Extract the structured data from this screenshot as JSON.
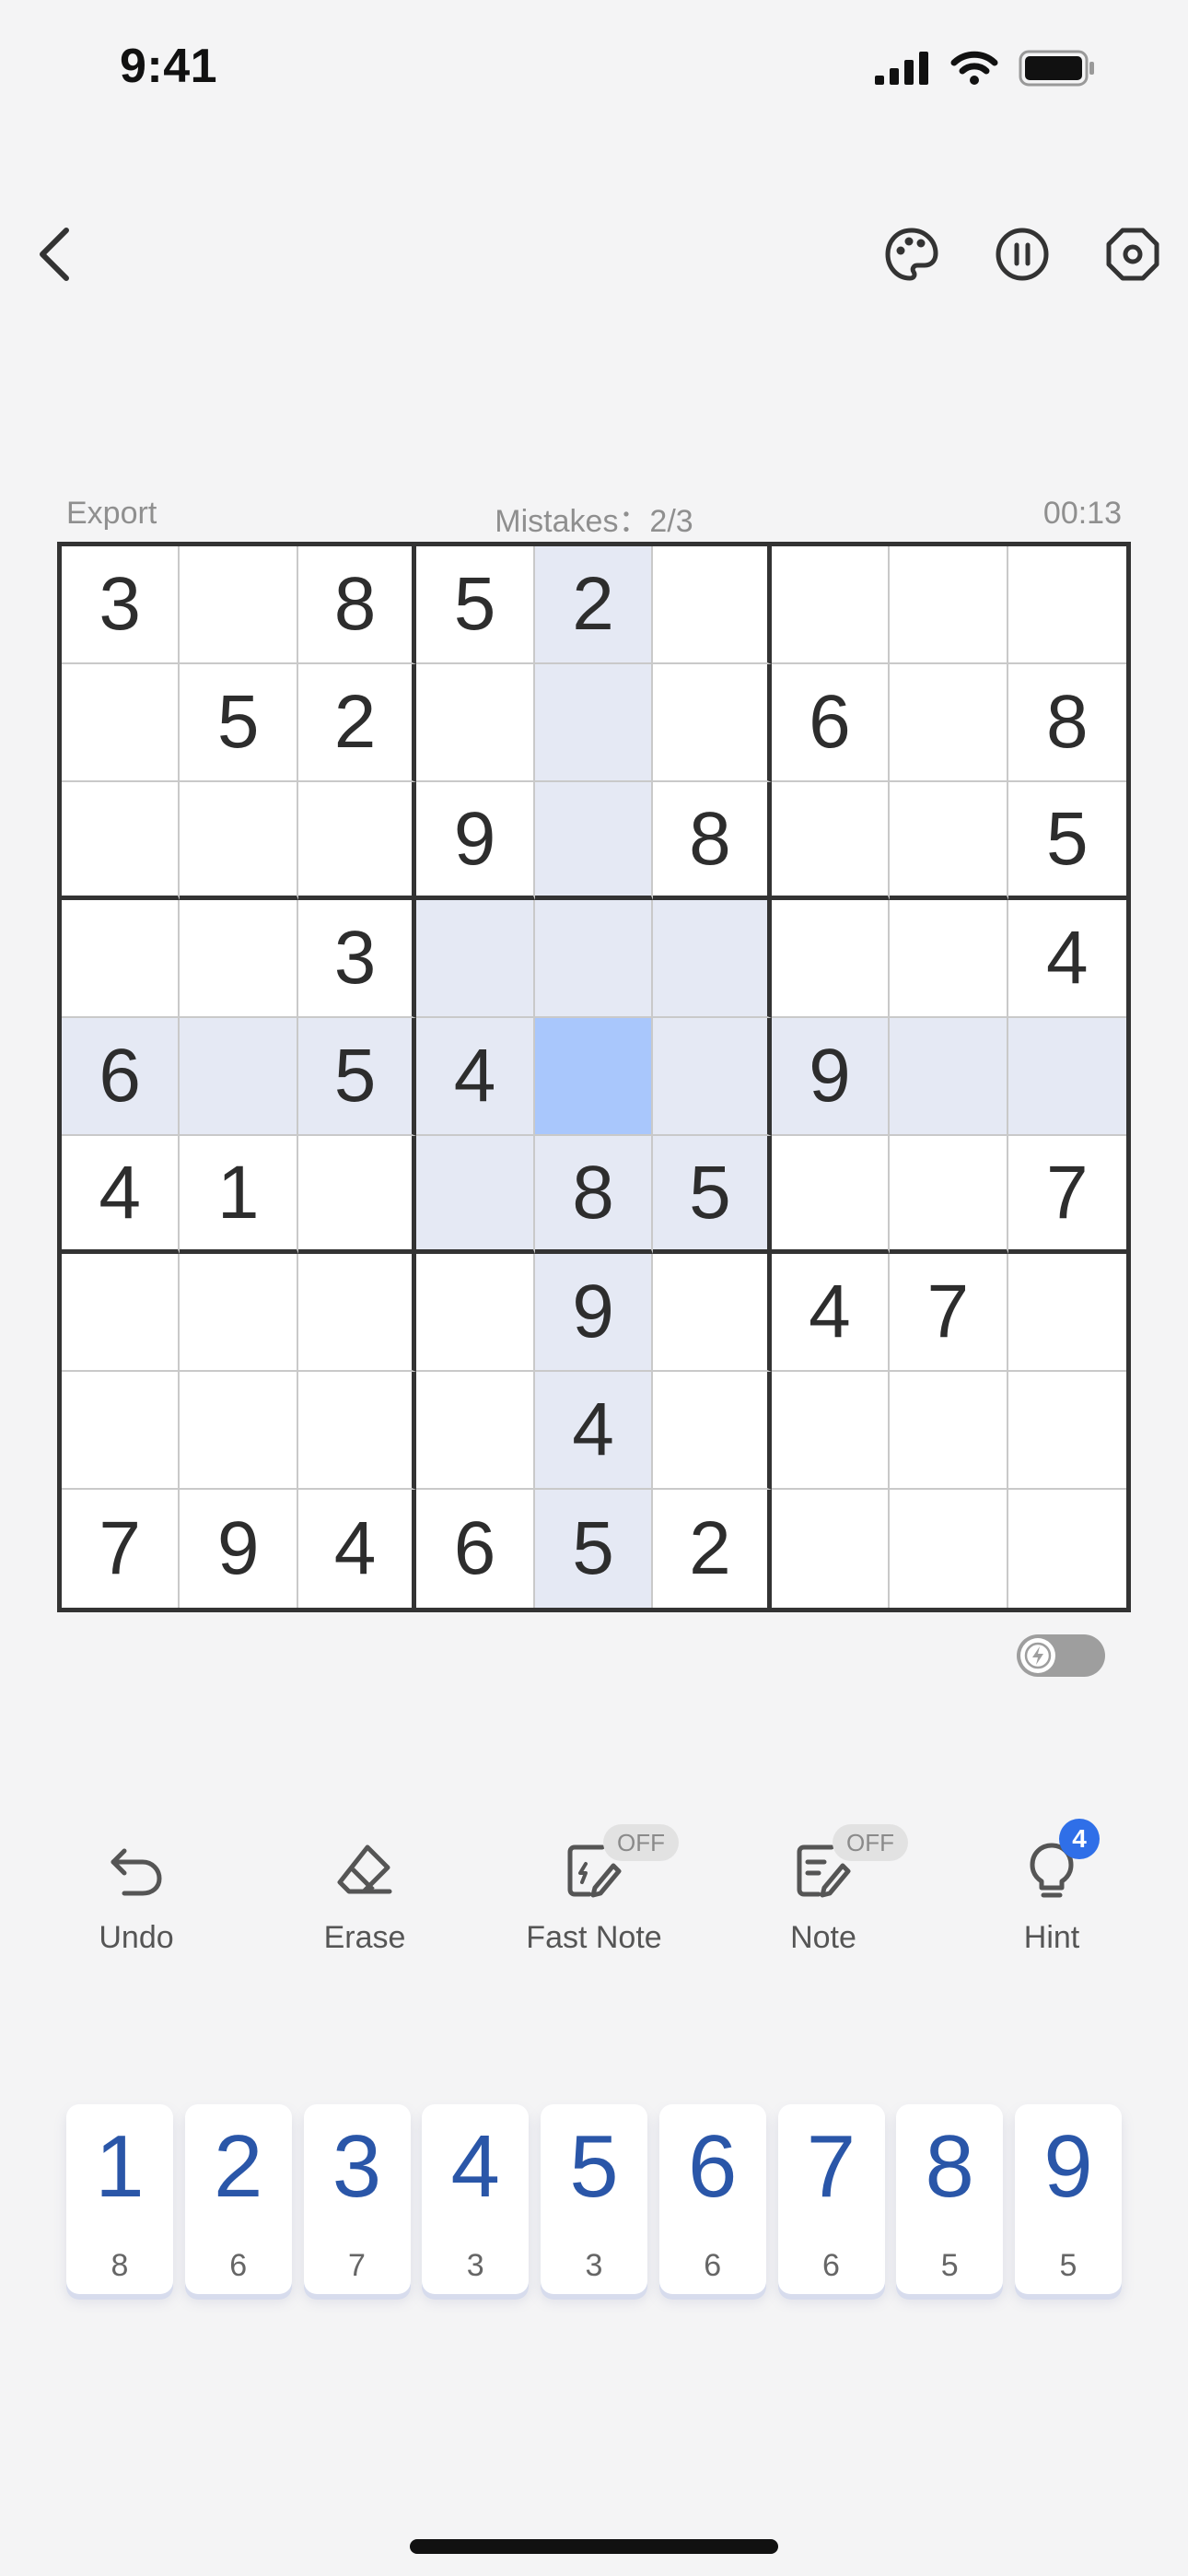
{
  "status_bar": {
    "time": "9:41"
  },
  "header": {
    "back_icon": "chevron-left-icon",
    "palette_icon": "palette-icon",
    "pause_icon": "pause-icon",
    "settings_icon": "settings-icon"
  },
  "info": {
    "export_label": "Export",
    "mistakes_label": "Mistakes：2/3",
    "timer": "00:13"
  },
  "board": {
    "rows": [
      [
        "3",
        "",
        "8",
        "5",
        "2",
        "",
        "",
        "",
        ""
      ],
      [
        "",
        "5",
        "2",
        "",
        "",
        "",
        "6",
        "",
        "8"
      ],
      [
        "",
        "",
        "",
        "9",
        "",
        "8",
        "",
        "",
        "5"
      ],
      [
        "",
        "",
        "3",
        "",
        "",
        "",
        "",
        "",
        "4"
      ],
      [
        "6",
        "",
        "5",
        "4",
        "",
        "",
        "9",
        "",
        ""
      ],
      [
        "4",
        "1",
        "",
        "",
        "8",
        "5",
        "",
        "",
        "7"
      ],
      [
        "",
        "",
        "",
        "",
        "9",
        "",
        "4",
        "7",
        ""
      ],
      [
        "",
        "",
        "",
        "",
        "4",
        "",
        "",
        "",
        ""
      ],
      [
        "7",
        "9",
        "4",
        "6",
        "5",
        "2",
        "",
        "",
        ""
      ]
    ],
    "selected": {
      "row": 4,
      "col": 4
    },
    "colors": {
      "highlight": "#e5e9f4",
      "selected": "#a9c7fc",
      "given": "#2d2d2d"
    }
  },
  "quick_toggle": {
    "icon": "lightning-icon",
    "on": false
  },
  "tools": [
    {
      "id": "undo",
      "label": "Undo",
      "icon": "undo-icon"
    },
    {
      "id": "erase",
      "label": "Erase",
      "icon": "eraser-icon"
    },
    {
      "id": "fast-note",
      "label": "Fast Note",
      "icon": "fast-note-icon",
      "badge": "OFF"
    },
    {
      "id": "note",
      "label": "Note",
      "icon": "note-icon",
      "badge": "OFF"
    },
    {
      "id": "hint",
      "label": "Hint",
      "icon": "lightbulb-icon",
      "count": "4"
    }
  ],
  "number_pad": [
    {
      "digit": "1",
      "remaining": "8"
    },
    {
      "digit": "2",
      "remaining": "6"
    },
    {
      "digit": "3",
      "remaining": "7"
    },
    {
      "digit": "4",
      "remaining": "3"
    },
    {
      "digit": "5",
      "remaining": "3"
    },
    {
      "digit": "6",
      "remaining": "6"
    },
    {
      "digit": "7",
      "remaining": "6"
    },
    {
      "digit": "8",
      "remaining": "5"
    },
    {
      "digit": "9",
      "remaining": "5"
    }
  ],
  "accent_color": "#2a56a8"
}
